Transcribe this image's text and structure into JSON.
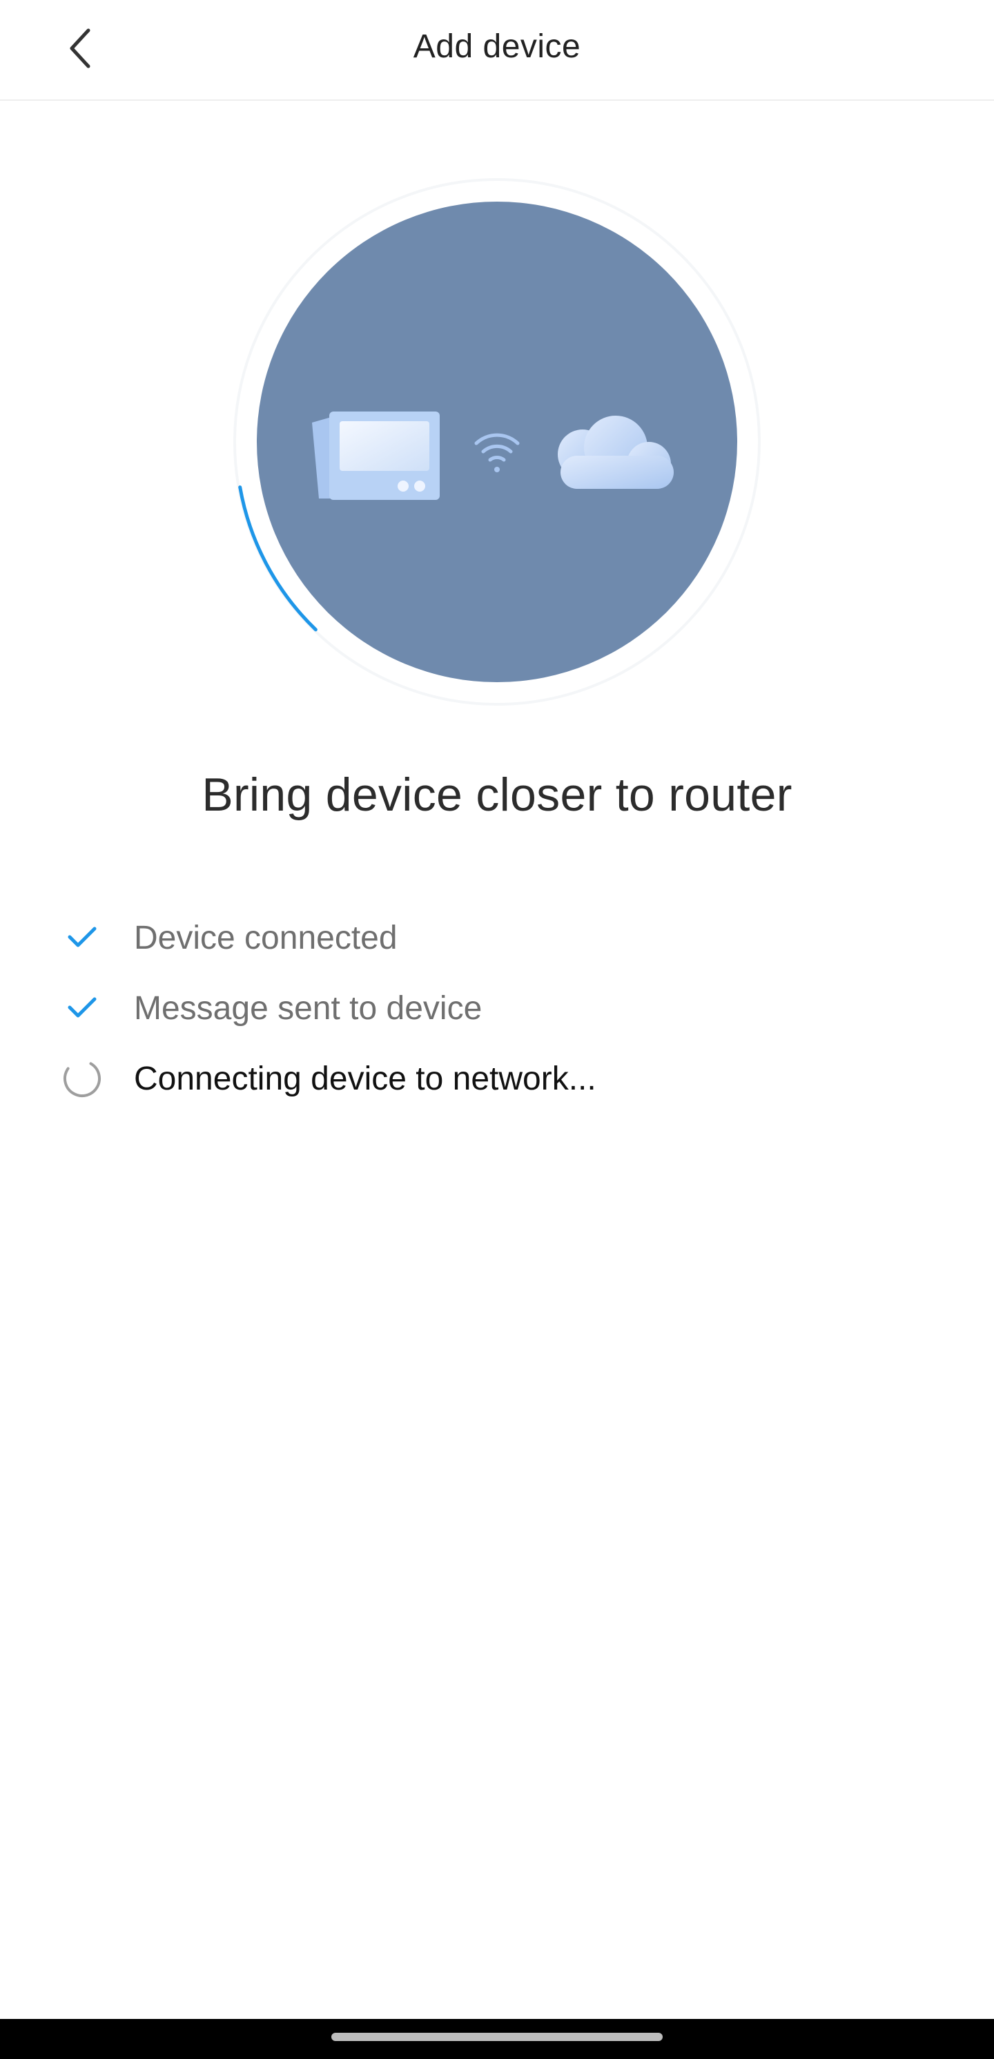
{
  "header": {
    "title": "Add device",
    "back_icon": "chevron-left-icon"
  },
  "illustration": {
    "circle_color": "#6f8aad",
    "accent_color": "#1e96e8",
    "progress": 0.1,
    "icons": [
      "thermostat-device-icon",
      "wifi-icon",
      "cloud-icon"
    ]
  },
  "headline": "Bring device closer to router",
  "steps": [
    {
      "label": "Device connected",
      "status": "done",
      "icon": "check-icon"
    },
    {
      "label": "Message sent to device",
      "status": "done",
      "icon": "check-icon"
    },
    {
      "label": "Connecting device to network...",
      "status": "in-progress",
      "icon": "spinner-icon"
    }
  ],
  "colors": {
    "check": "#1e96e8",
    "done_text": "#6f6f6f",
    "active_text": "#111111",
    "spinner": "#9e9e9e"
  }
}
